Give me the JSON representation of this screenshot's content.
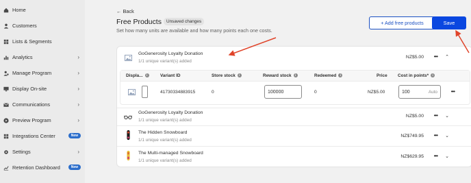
{
  "sidebar": {
    "items": [
      {
        "label": "Home",
        "icon": "home-icon",
        "chevron": false,
        "badge": ""
      },
      {
        "label": "Customers",
        "icon": "person-icon",
        "chevron": false,
        "badge": ""
      },
      {
        "label": "Lists & Segments",
        "icon": "list-icon",
        "chevron": false,
        "badge": ""
      },
      {
        "label": "Analytics",
        "icon": "bar-chart-icon",
        "chevron": true,
        "badge": ""
      },
      {
        "label": "Manage Program",
        "icon": "person-gear-icon",
        "chevron": true,
        "badge": ""
      },
      {
        "label": "Display On-site",
        "icon": "monitor-icon",
        "chevron": true,
        "badge": ""
      },
      {
        "label": "Communications",
        "icon": "mail-icon",
        "chevron": true,
        "badge": ""
      },
      {
        "label": "Preview Program",
        "icon": "play-icon",
        "chevron": true,
        "badge": ""
      },
      {
        "label": "Integrations Center",
        "icon": "apps-icon",
        "chevron": false,
        "badge": "New"
      },
      {
        "label": "Settings",
        "icon": "gear-icon",
        "chevron": true,
        "badge": ""
      },
      {
        "label": "Retention Dashboard",
        "icon": "line-chart-icon",
        "chevron": false,
        "badge": "New"
      }
    ]
  },
  "header": {
    "back_label": "← Back",
    "title": "Free Products",
    "unsaved_badge": "Unsaved changes",
    "subtitle": "Set how many units are available and how many points each one costs.",
    "add_button": "+ Add free products",
    "save_button": "Save"
  },
  "products": [
    {
      "name": "GoGenerosity Loyalty Donation",
      "variants": "1/1 unique variant(s) added",
      "price": "NZ$5.00",
      "icon": "image-placeholder-icon",
      "expanded": true
    },
    {
      "name": "GoGenerosity Loyalty Donation",
      "variants": "1/1 unique variant(s) added",
      "price": "NZ$5.00",
      "icon": "glasses-icon",
      "expanded": false
    },
    {
      "name": "The Hidden Snowboard",
      "variants": "1/1 unique variant(s) added",
      "price": "NZ$749.95",
      "icon": "snowboard-icon",
      "expanded": false
    },
    {
      "name": "The Multi-managed Snowboard",
      "variants": "1/1 unique variant(s) added",
      "price": "NZ$629.95",
      "icon": "snowboard-yellow-icon",
      "expanded": false
    }
  ],
  "variant_table": {
    "headers": {
      "display": "Displa...",
      "variant_id": "Variant ID",
      "store_stock": "Store stock",
      "reward_stock": "Reward stock",
      "redeemed": "Redeemed",
      "price": "Price",
      "cost": "Cost in points*"
    },
    "row": {
      "variant_id": "41730334883915",
      "store_stock": "0",
      "reward_stock": "100000",
      "redeemed": "0",
      "price": "NZ$5.00",
      "cost": "100",
      "cost_suffix": "Auto"
    }
  },
  "colors": {
    "accent": "#0a47e0",
    "annotation_arrow": "#e0442a",
    "badge_new": "#2c6ecb"
  }
}
